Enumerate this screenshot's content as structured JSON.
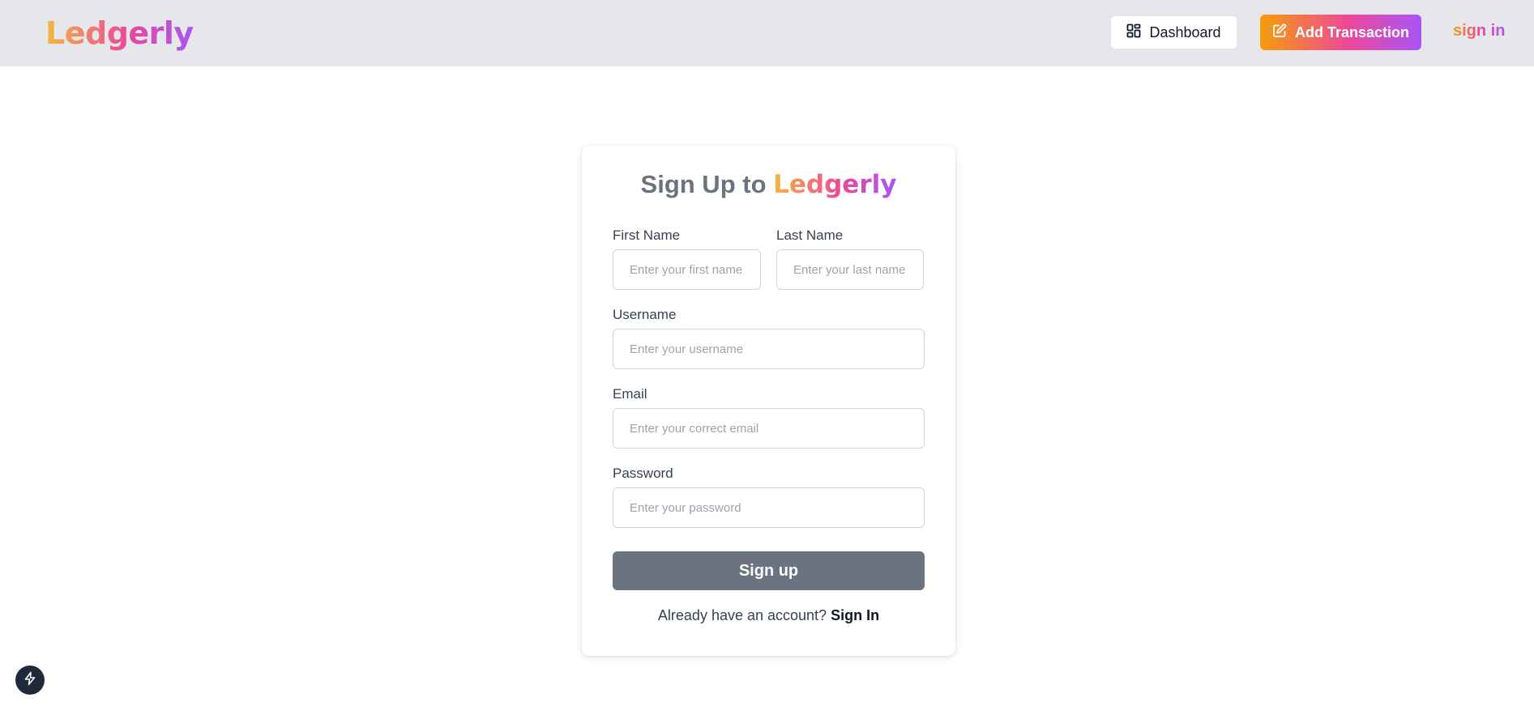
{
  "header": {
    "brand": "Ledgerly",
    "dashboard_label": "Dashboard",
    "dashboard_icon": "grid-icon",
    "add_transaction_label": "Add Transaction",
    "add_transaction_icon": "edit-icon",
    "signin_label": "sign in"
  },
  "form": {
    "title_prefix": "Sign Up to",
    "title_brand": "Ledgerly",
    "fields": {
      "first_name": {
        "label": "First Name",
        "placeholder": "Enter your first name",
        "value": ""
      },
      "last_name": {
        "label": "Last Name",
        "placeholder": "Enter your last name",
        "value": ""
      },
      "username": {
        "label": "Username",
        "placeholder": "Enter your username",
        "value": ""
      },
      "email": {
        "label": "Email",
        "placeholder": "Enter your correct email",
        "value": ""
      },
      "password": {
        "label": "Password",
        "placeholder": "Enter your password",
        "value": ""
      }
    },
    "submit_label": "Sign up",
    "footer_text": "Already have an account?",
    "footer_link": "Sign In"
  },
  "floating": {
    "icon": "bolt-icon"
  },
  "colors": {
    "topbar_bg": "#e5e7eb",
    "brand_gradient_start": "#f6b73c",
    "brand_gradient_mid": "#ec4899",
    "brand_gradient_end": "#a855f7",
    "submit_bg": "#6b7280"
  }
}
